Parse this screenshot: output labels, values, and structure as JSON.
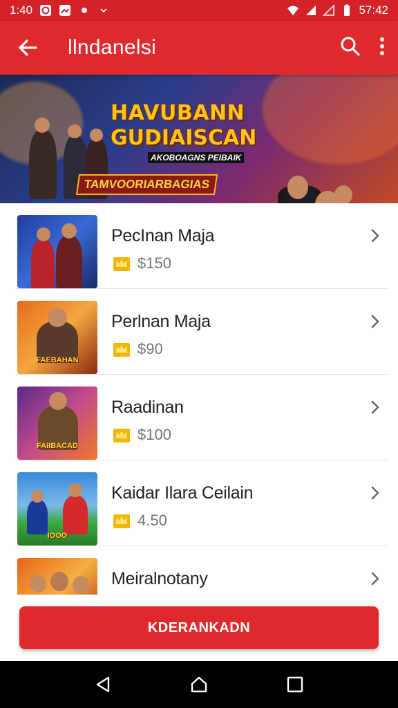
{
  "status_bar": {
    "time_left": "1:40",
    "time_right": "57:42"
  },
  "app_bar": {
    "title": "llndanelsi"
  },
  "hero": {
    "line1": "HAVUBANN",
    "line2": "GUDIAISCAN",
    "line3": "AKOBOAGNS PEIBAIK",
    "line4": "TAMVOORIARBAGIAS"
  },
  "items": [
    {
      "name": "PecInan Maja",
      "price": "$150",
      "thumb_caption": ""
    },
    {
      "name": "Perlnan Maja",
      "price": "$90",
      "thumb_caption": "FAEBAHAN"
    },
    {
      "name": "Raadinan",
      "price": "$100",
      "thumb_caption": "FAIIBACAD"
    },
    {
      "name": "Kaidar Ilara Ceilain",
      "price": "4.50",
      "thumb_caption": "IOOO"
    },
    {
      "name": "Meiralnotany",
      "price": "",
      "thumb_caption": ""
    }
  ],
  "cta": {
    "label": "KDERANKADN"
  },
  "colors": {
    "primary": "#e02a2e",
    "status_bar": "#d32228",
    "nav_bar": "#000000",
    "crown": "#f2b705"
  },
  "icons": [
    "back-arrow-icon",
    "search-icon",
    "more-vert-icon",
    "crown-icon",
    "chevron-right-icon",
    "nav-back-icon",
    "nav-home-icon",
    "nav-recents-icon"
  ]
}
